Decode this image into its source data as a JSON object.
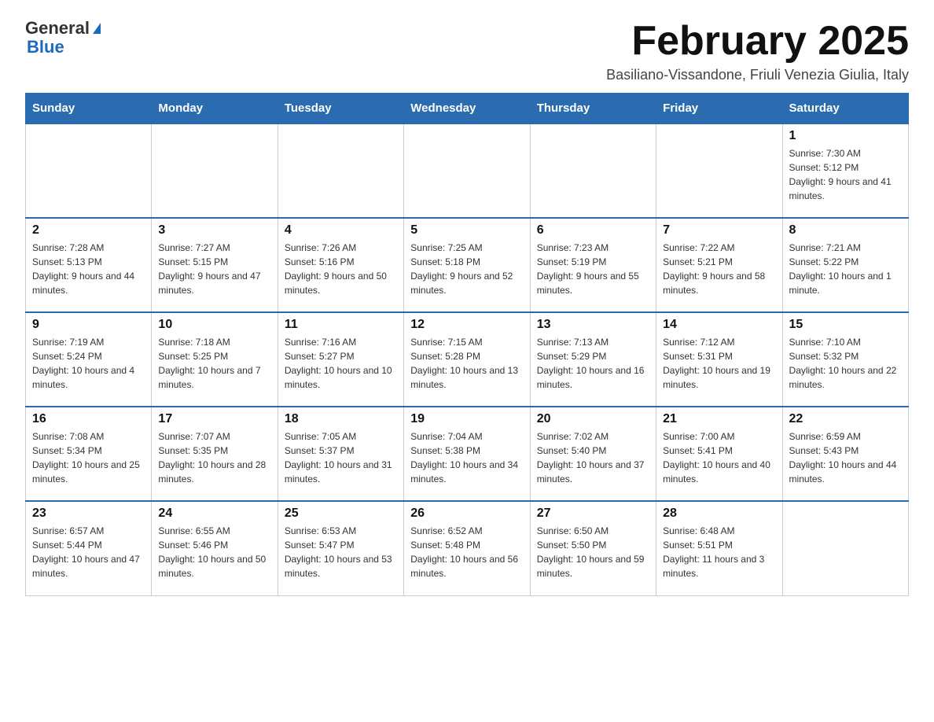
{
  "logo": {
    "line1": "General",
    "line2": "Blue"
  },
  "header": {
    "title": "February 2025",
    "subtitle": "Basiliano-Vissandone, Friuli Venezia Giulia, Italy"
  },
  "weekdays": [
    "Sunday",
    "Monday",
    "Tuesday",
    "Wednesday",
    "Thursday",
    "Friday",
    "Saturday"
  ],
  "weeks": [
    [
      {
        "day": "",
        "info": ""
      },
      {
        "day": "",
        "info": ""
      },
      {
        "day": "",
        "info": ""
      },
      {
        "day": "",
        "info": ""
      },
      {
        "day": "",
        "info": ""
      },
      {
        "day": "",
        "info": ""
      },
      {
        "day": "1",
        "info": "Sunrise: 7:30 AM\nSunset: 5:12 PM\nDaylight: 9 hours and 41 minutes."
      }
    ],
    [
      {
        "day": "2",
        "info": "Sunrise: 7:28 AM\nSunset: 5:13 PM\nDaylight: 9 hours and 44 minutes."
      },
      {
        "day": "3",
        "info": "Sunrise: 7:27 AM\nSunset: 5:15 PM\nDaylight: 9 hours and 47 minutes."
      },
      {
        "day": "4",
        "info": "Sunrise: 7:26 AM\nSunset: 5:16 PM\nDaylight: 9 hours and 50 minutes."
      },
      {
        "day": "5",
        "info": "Sunrise: 7:25 AM\nSunset: 5:18 PM\nDaylight: 9 hours and 52 minutes."
      },
      {
        "day": "6",
        "info": "Sunrise: 7:23 AM\nSunset: 5:19 PM\nDaylight: 9 hours and 55 minutes."
      },
      {
        "day": "7",
        "info": "Sunrise: 7:22 AM\nSunset: 5:21 PM\nDaylight: 9 hours and 58 minutes."
      },
      {
        "day": "8",
        "info": "Sunrise: 7:21 AM\nSunset: 5:22 PM\nDaylight: 10 hours and 1 minute."
      }
    ],
    [
      {
        "day": "9",
        "info": "Sunrise: 7:19 AM\nSunset: 5:24 PM\nDaylight: 10 hours and 4 minutes."
      },
      {
        "day": "10",
        "info": "Sunrise: 7:18 AM\nSunset: 5:25 PM\nDaylight: 10 hours and 7 minutes."
      },
      {
        "day": "11",
        "info": "Sunrise: 7:16 AM\nSunset: 5:27 PM\nDaylight: 10 hours and 10 minutes."
      },
      {
        "day": "12",
        "info": "Sunrise: 7:15 AM\nSunset: 5:28 PM\nDaylight: 10 hours and 13 minutes."
      },
      {
        "day": "13",
        "info": "Sunrise: 7:13 AM\nSunset: 5:29 PM\nDaylight: 10 hours and 16 minutes."
      },
      {
        "day": "14",
        "info": "Sunrise: 7:12 AM\nSunset: 5:31 PM\nDaylight: 10 hours and 19 minutes."
      },
      {
        "day": "15",
        "info": "Sunrise: 7:10 AM\nSunset: 5:32 PM\nDaylight: 10 hours and 22 minutes."
      }
    ],
    [
      {
        "day": "16",
        "info": "Sunrise: 7:08 AM\nSunset: 5:34 PM\nDaylight: 10 hours and 25 minutes."
      },
      {
        "day": "17",
        "info": "Sunrise: 7:07 AM\nSunset: 5:35 PM\nDaylight: 10 hours and 28 minutes."
      },
      {
        "day": "18",
        "info": "Sunrise: 7:05 AM\nSunset: 5:37 PM\nDaylight: 10 hours and 31 minutes."
      },
      {
        "day": "19",
        "info": "Sunrise: 7:04 AM\nSunset: 5:38 PM\nDaylight: 10 hours and 34 minutes."
      },
      {
        "day": "20",
        "info": "Sunrise: 7:02 AM\nSunset: 5:40 PM\nDaylight: 10 hours and 37 minutes."
      },
      {
        "day": "21",
        "info": "Sunrise: 7:00 AM\nSunset: 5:41 PM\nDaylight: 10 hours and 40 minutes."
      },
      {
        "day": "22",
        "info": "Sunrise: 6:59 AM\nSunset: 5:43 PM\nDaylight: 10 hours and 44 minutes."
      }
    ],
    [
      {
        "day": "23",
        "info": "Sunrise: 6:57 AM\nSunset: 5:44 PM\nDaylight: 10 hours and 47 minutes."
      },
      {
        "day": "24",
        "info": "Sunrise: 6:55 AM\nSunset: 5:46 PM\nDaylight: 10 hours and 50 minutes."
      },
      {
        "day": "25",
        "info": "Sunrise: 6:53 AM\nSunset: 5:47 PM\nDaylight: 10 hours and 53 minutes."
      },
      {
        "day": "26",
        "info": "Sunrise: 6:52 AM\nSunset: 5:48 PM\nDaylight: 10 hours and 56 minutes."
      },
      {
        "day": "27",
        "info": "Sunrise: 6:50 AM\nSunset: 5:50 PM\nDaylight: 10 hours and 59 minutes."
      },
      {
        "day": "28",
        "info": "Sunrise: 6:48 AM\nSunset: 5:51 PM\nDaylight: 11 hours and 3 minutes."
      },
      {
        "day": "",
        "info": ""
      }
    ]
  ]
}
